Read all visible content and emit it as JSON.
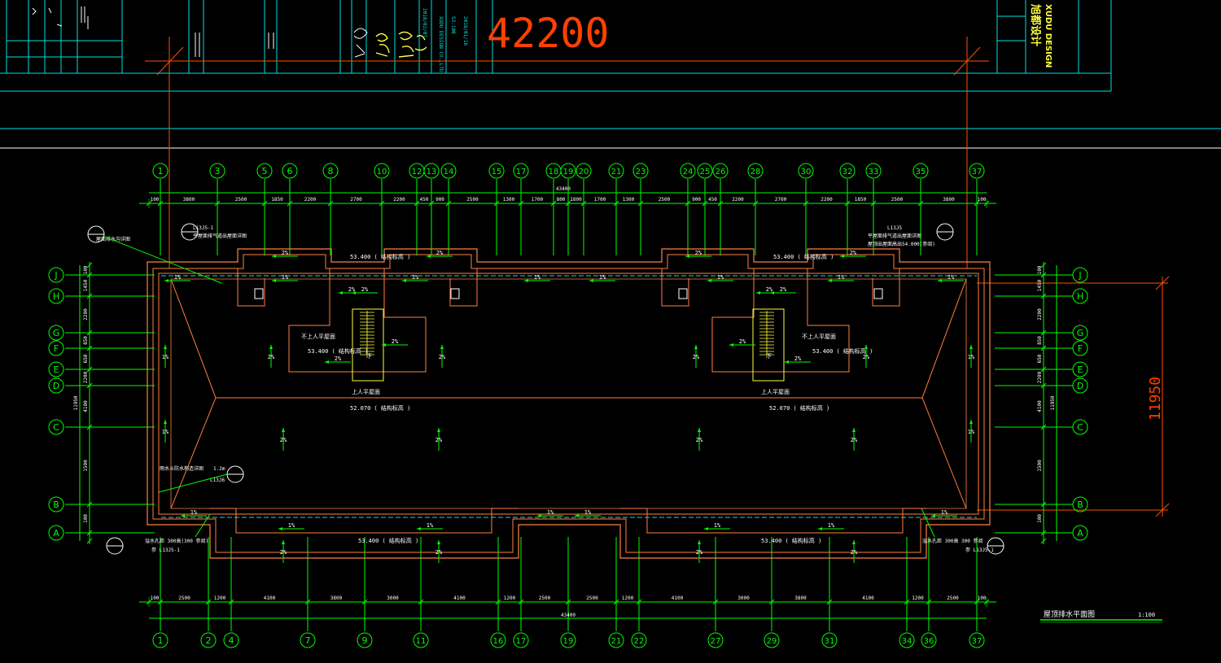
{
  "drawing": {
    "title": "屋顶排水平面图",
    "scale": "1:100",
    "overall_width_label": "42200",
    "overall_depth_label": "11950",
    "total_dim_top": "43400",
    "total_dim_bottom": "43400"
  },
  "title_block": {
    "company_en": "XUDU DESIGN",
    "company_cn": "旭都设计",
    "vertical_notes": [
      "XUDU DESIGN CO.,LTD",
      "S3.100",
      "2018/01/16",
      "2018/02/07"
    ]
  },
  "axes_top": [
    "1",
    "3",
    "5",
    "6",
    "8",
    "10",
    "12",
    "13",
    "14",
    "15",
    "17",
    "18",
    "19",
    "20",
    "21",
    "23",
    "24",
    "25",
    "26",
    "28",
    "30",
    "32",
    "33",
    "35",
    "37"
  ],
  "axes_bottom": [
    "1",
    "2",
    "4",
    "7",
    "9",
    "11",
    "16",
    "17",
    "19",
    "21",
    "22",
    "27",
    "29",
    "31",
    "34",
    "36",
    "37"
  ],
  "axes_rows": [
    "J",
    "H",
    "G",
    "F",
    "E",
    "D",
    "C",
    "B",
    "A"
  ],
  "dims_top": [
    "100",
    "3800",
    "2500",
    "1850",
    "2200",
    "2700",
    "2200",
    "450",
    "900",
    "2500",
    "1300",
    "1700",
    "800",
    "1800",
    "1700",
    "1300",
    "2500",
    "900",
    "450",
    "2200",
    "2700",
    "2200",
    "1850",
    "2500",
    "3800",
    "100"
  ],
  "dims_bottom": [
    "100",
    "2500",
    "1200",
    "4100",
    "3800",
    "3000",
    "4100",
    "1200",
    "2500",
    "2500",
    "1200",
    "4100",
    "3000",
    "3800",
    "4100",
    "1200",
    "2500",
    "100"
  ],
  "dims_left": [
    "100",
    "1450",
    "2200",
    "850",
    "650",
    "2200",
    "4100",
    "1500",
    "100"
  ],
  "dims_left_total": "11950",
  "dims_right": [
    "100",
    "1450",
    "2200",
    "850",
    "650",
    "2200",
    "4100",
    "1500",
    "100"
  ],
  "dims_right_total": "11950",
  "labels": {
    "upper_roof": "上人平屋面",
    "non_upper_roof": "不上人平屋面",
    "elev_parapet": "53.400 ( 结构标高 )",
    "elev_main": "52.070 ( 结构标高 )",
    "elev_left_parapet": "53.400 ( 结构标高 )",
    "slope_2": "2%",
    "slope_1": "1%",
    "down": "下",
    "note_left_top": "平屋面排气道出屋面详图",
    "note_left_top_ref": "L13J5-1",
    "note_left_callout": "屋面排水沟详图",
    "note_right_top": "平屋面排气道出屋面详图",
    "note_right_top2": "屋顶出屋面高出54.000(参阅)",
    "note_right_ref": "L13J5",
    "note_overflow_left": "溢水孔距  300高(300 参阅)",
    "note_overflow_left2": "参 L13J5-1",
    "note_overflow_right": "溢水孔距  300高  300 参阅",
    "note_overflow_right2": "参 L13J5-1",
    "note_left_mid": "雨水斗防水构造详图",
    "note_left_mid_ref": "L13J6",
    "note_left_mid_num": "1.2m"
  },
  "colors": {
    "axis": "#00ff00",
    "wall": "#ff8040",
    "dim": "#ff3000",
    "cyan": "#00e0e0",
    "yellow": "#ffff40",
    "white": "#ffffff"
  }
}
